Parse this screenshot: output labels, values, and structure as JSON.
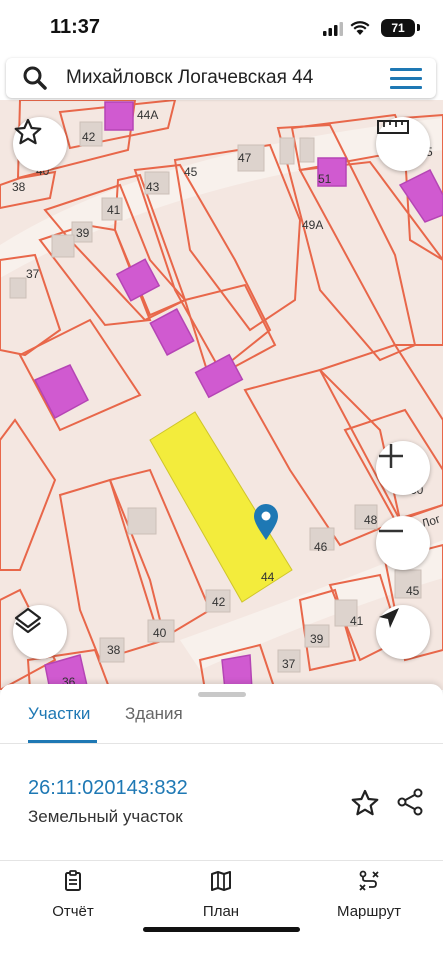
{
  "status": {
    "time": "11:37",
    "battery": "71"
  },
  "search": {
    "query": "Михайловск Логачевская 44"
  },
  "map": {
    "house_numbers": [
      "42",
      "44А",
      "38",
      "40",
      "43",
      "45",
      "47",
      "41",
      "39",
      "37",
      "51",
      "5",
      "49А",
      "44",
      "42",
      "40",
      "38",
      "36",
      "46",
      "48",
      "45",
      "41",
      "39",
      "37",
      "50"
    ],
    "street_label": "Лог",
    "marker": "location-pin-icon"
  },
  "tabs": [
    {
      "label": "Участки"
    },
    {
      "label": "Здания"
    }
  ],
  "parcel": {
    "cadastral": "26:11:020143:832",
    "type": "Земельный участок"
  },
  "bottom_nav": [
    {
      "label": "Отчёт",
      "icon": "report-icon"
    },
    {
      "label": "План",
      "icon": "map-plan-icon"
    },
    {
      "label": "Маршрут",
      "icon": "route-icon"
    }
  ],
  "colors": {
    "accent": "#1e78b4",
    "parcel_border": "#e8674a",
    "building": "#d05ad0",
    "selected": "#f3ec3c"
  }
}
